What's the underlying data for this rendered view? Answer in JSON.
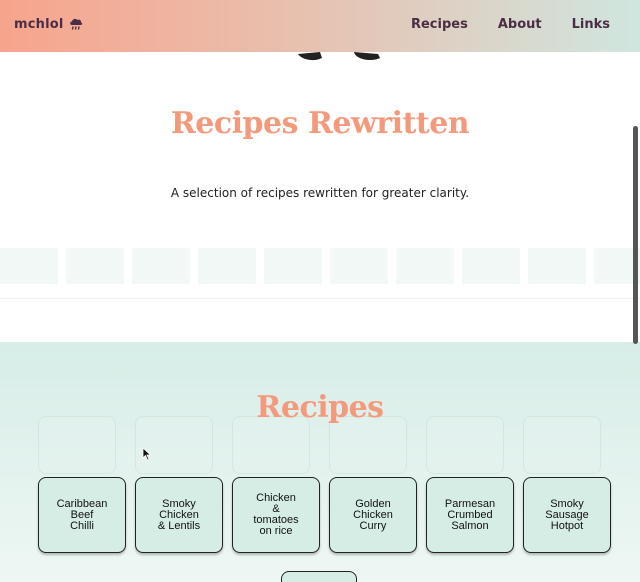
{
  "header": {
    "brand": "mchlol",
    "brand_icon": "cloud-rain-icon",
    "nav": [
      {
        "label": "Recipes"
      },
      {
        "label": "About"
      },
      {
        "label": "Links"
      }
    ]
  },
  "hero": {
    "title": "Recipes Rewritten",
    "subtitle": "A selection of recipes rewritten for greater clarity."
  },
  "recipes": {
    "title": "Recipes",
    "cards": [
      {
        "label": "Caribbean\nBeef\nChilli"
      },
      {
        "label": "Smoky\nChicken\n& Lentils"
      },
      {
        "label": "Chicken\n&\ntomatoes\non rice"
      },
      {
        "label": "Golden\nChicken\nCurry"
      },
      {
        "label": "Parmesan\nCrumbed\nSalmon"
      },
      {
        "label": "Smoky\nSausage\nHotpot"
      }
    ]
  },
  "colors": {
    "accent": "#f49a7c",
    "brand_text": "#4b2e45",
    "card_bg": "#d6ede6",
    "section_bg": "#d7ede7"
  }
}
